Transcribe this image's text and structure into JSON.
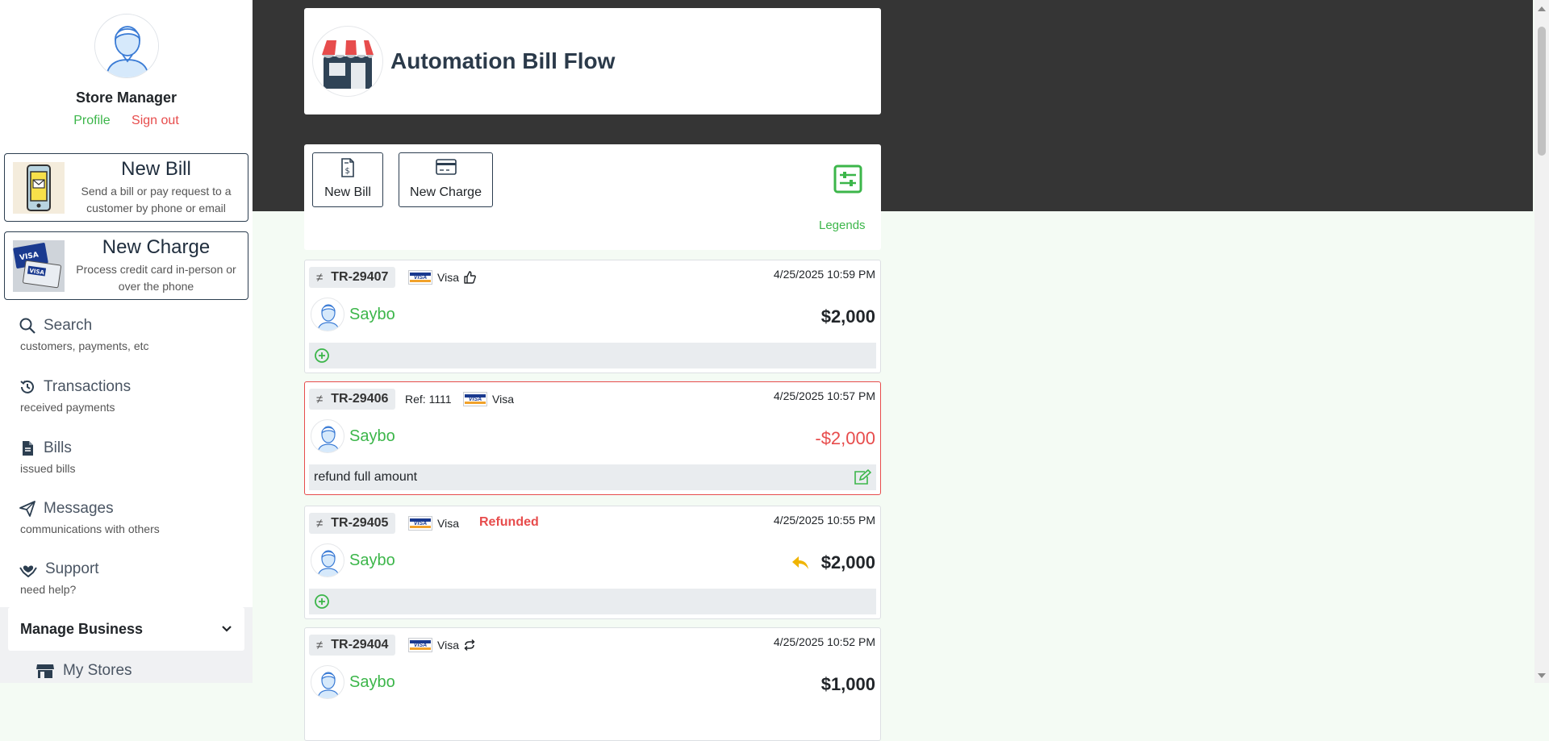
{
  "sidebar": {
    "user_role": "Store Manager",
    "profile_link": "Profile",
    "signout_link": "Sign out",
    "actions": [
      {
        "title": "New Bill",
        "description": "Send a bill or pay request to a customer by phone or email"
      },
      {
        "title": "New Charge",
        "description": "Process credit card in-person or over the phone"
      }
    ],
    "nav": [
      {
        "label": "Search",
        "desc": "customers, payments, etc",
        "icon": "search-icon"
      },
      {
        "label": "Transactions",
        "desc": "received payments",
        "icon": "history-icon"
      },
      {
        "label": "Bills",
        "desc": "issued bills",
        "icon": "document-icon"
      },
      {
        "label": "Messages",
        "desc": "communications with others",
        "icon": "send-icon"
      },
      {
        "label": "Support",
        "desc": "need help?",
        "icon": "support-icon"
      }
    ],
    "manage_business": {
      "label": "Manage Business",
      "icon": "chevron-down-icon"
    },
    "my_stores": {
      "label": "My Stores",
      "icon": "store-icon"
    }
  },
  "header": {
    "title": "Automation Bill Flow",
    "logo_icon": "storefront-icon"
  },
  "toolbar": {
    "new_bill_label": "New Bill",
    "new_charge_label": "New Charge",
    "legends_label": "Legends",
    "filter_icon": "sliders-icon"
  },
  "transactions": [
    {
      "id": "TR-29407",
      "ref": "",
      "card": "Visa",
      "status": "",
      "date": "4/25/2025 10:59 PM",
      "customer": "Saybo",
      "amount": "$2,000",
      "note": "",
      "indicator": "thumbs-up-icon"
    },
    {
      "id": "TR-29406",
      "ref": "Ref: 1111",
      "card": "Visa",
      "status": "",
      "date": "4/25/2025 10:57 PM",
      "customer": "Saybo",
      "amount": "-$2,000",
      "note": "refund full amount",
      "indicator": ""
    },
    {
      "id": "TR-29405",
      "ref": "",
      "card": "Visa",
      "status": "Refunded",
      "date": "4/25/2025 10:55 PM",
      "customer": "Saybo",
      "amount": "$2,000",
      "note": "",
      "indicator": "reply-icon"
    },
    {
      "id": "TR-29404",
      "ref": "",
      "card": "Visa",
      "status": "",
      "date": "4/25/2025 10:52 PM",
      "customer": "Saybo",
      "amount": "$1,000",
      "note": "",
      "indicator": "repeat-icon"
    }
  ],
  "colors": {
    "accent_green": "#3cb64a",
    "danger_red": "#e74c4c",
    "dark_band": "#353535",
    "refund_arrow": "#f0b400"
  }
}
